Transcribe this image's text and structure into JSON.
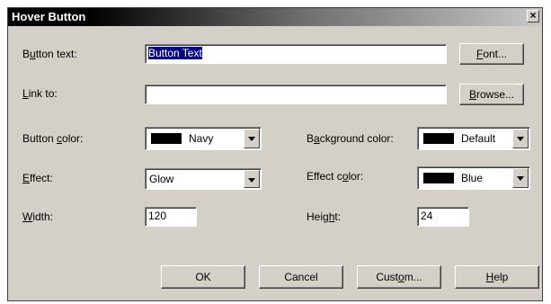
{
  "window": {
    "title": "Hover Button",
    "close_glyph": "×"
  },
  "fields": {
    "button_text": {
      "label_pre": "B",
      "label_u": "u",
      "label_post": "tton text:",
      "value": "Button Text"
    },
    "link_to": {
      "label_pre": "",
      "label_u": "L",
      "label_post": "ink to:",
      "value": ""
    },
    "button_color": {
      "label_pre": "Button ",
      "label_u": "c",
      "label_post": "olor:",
      "value": "Navy",
      "swatch": "#000000"
    },
    "background_color": {
      "label_pre": "B",
      "label_u": "a",
      "label_post": "ckground color:",
      "value": "Default",
      "swatch": "#000000"
    },
    "effect": {
      "label_pre": "",
      "label_u": "E",
      "label_post": "ffect:",
      "value": "Glow"
    },
    "effect_color": {
      "label_pre": "Effect c",
      "label_u": "o",
      "label_post": "lor:",
      "value": "Blue",
      "swatch": "#000000"
    },
    "width": {
      "label_pre": "",
      "label_u": "W",
      "label_post": "idth:",
      "value": "120"
    },
    "height": {
      "label_pre": "Heig",
      "label_u": "h",
      "label_post": "t:",
      "value": "24"
    }
  },
  "buttons": {
    "font": {
      "pre": "",
      "u": "F",
      "post": "ont..."
    },
    "browse": {
      "pre": "",
      "u": "B",
      "post": "rowse..."
    },
    "ok": {
      "label": "OK"
    },
    "cancel": {
      "label": "Cancel"
    },
    "custom": {
      "pre": "Cust",
      "u": "o",
      "post": "m..."
    },
    "help": {
      "pre": "",
      "u": "H",
      "post": "elp"
    }
  }
}
